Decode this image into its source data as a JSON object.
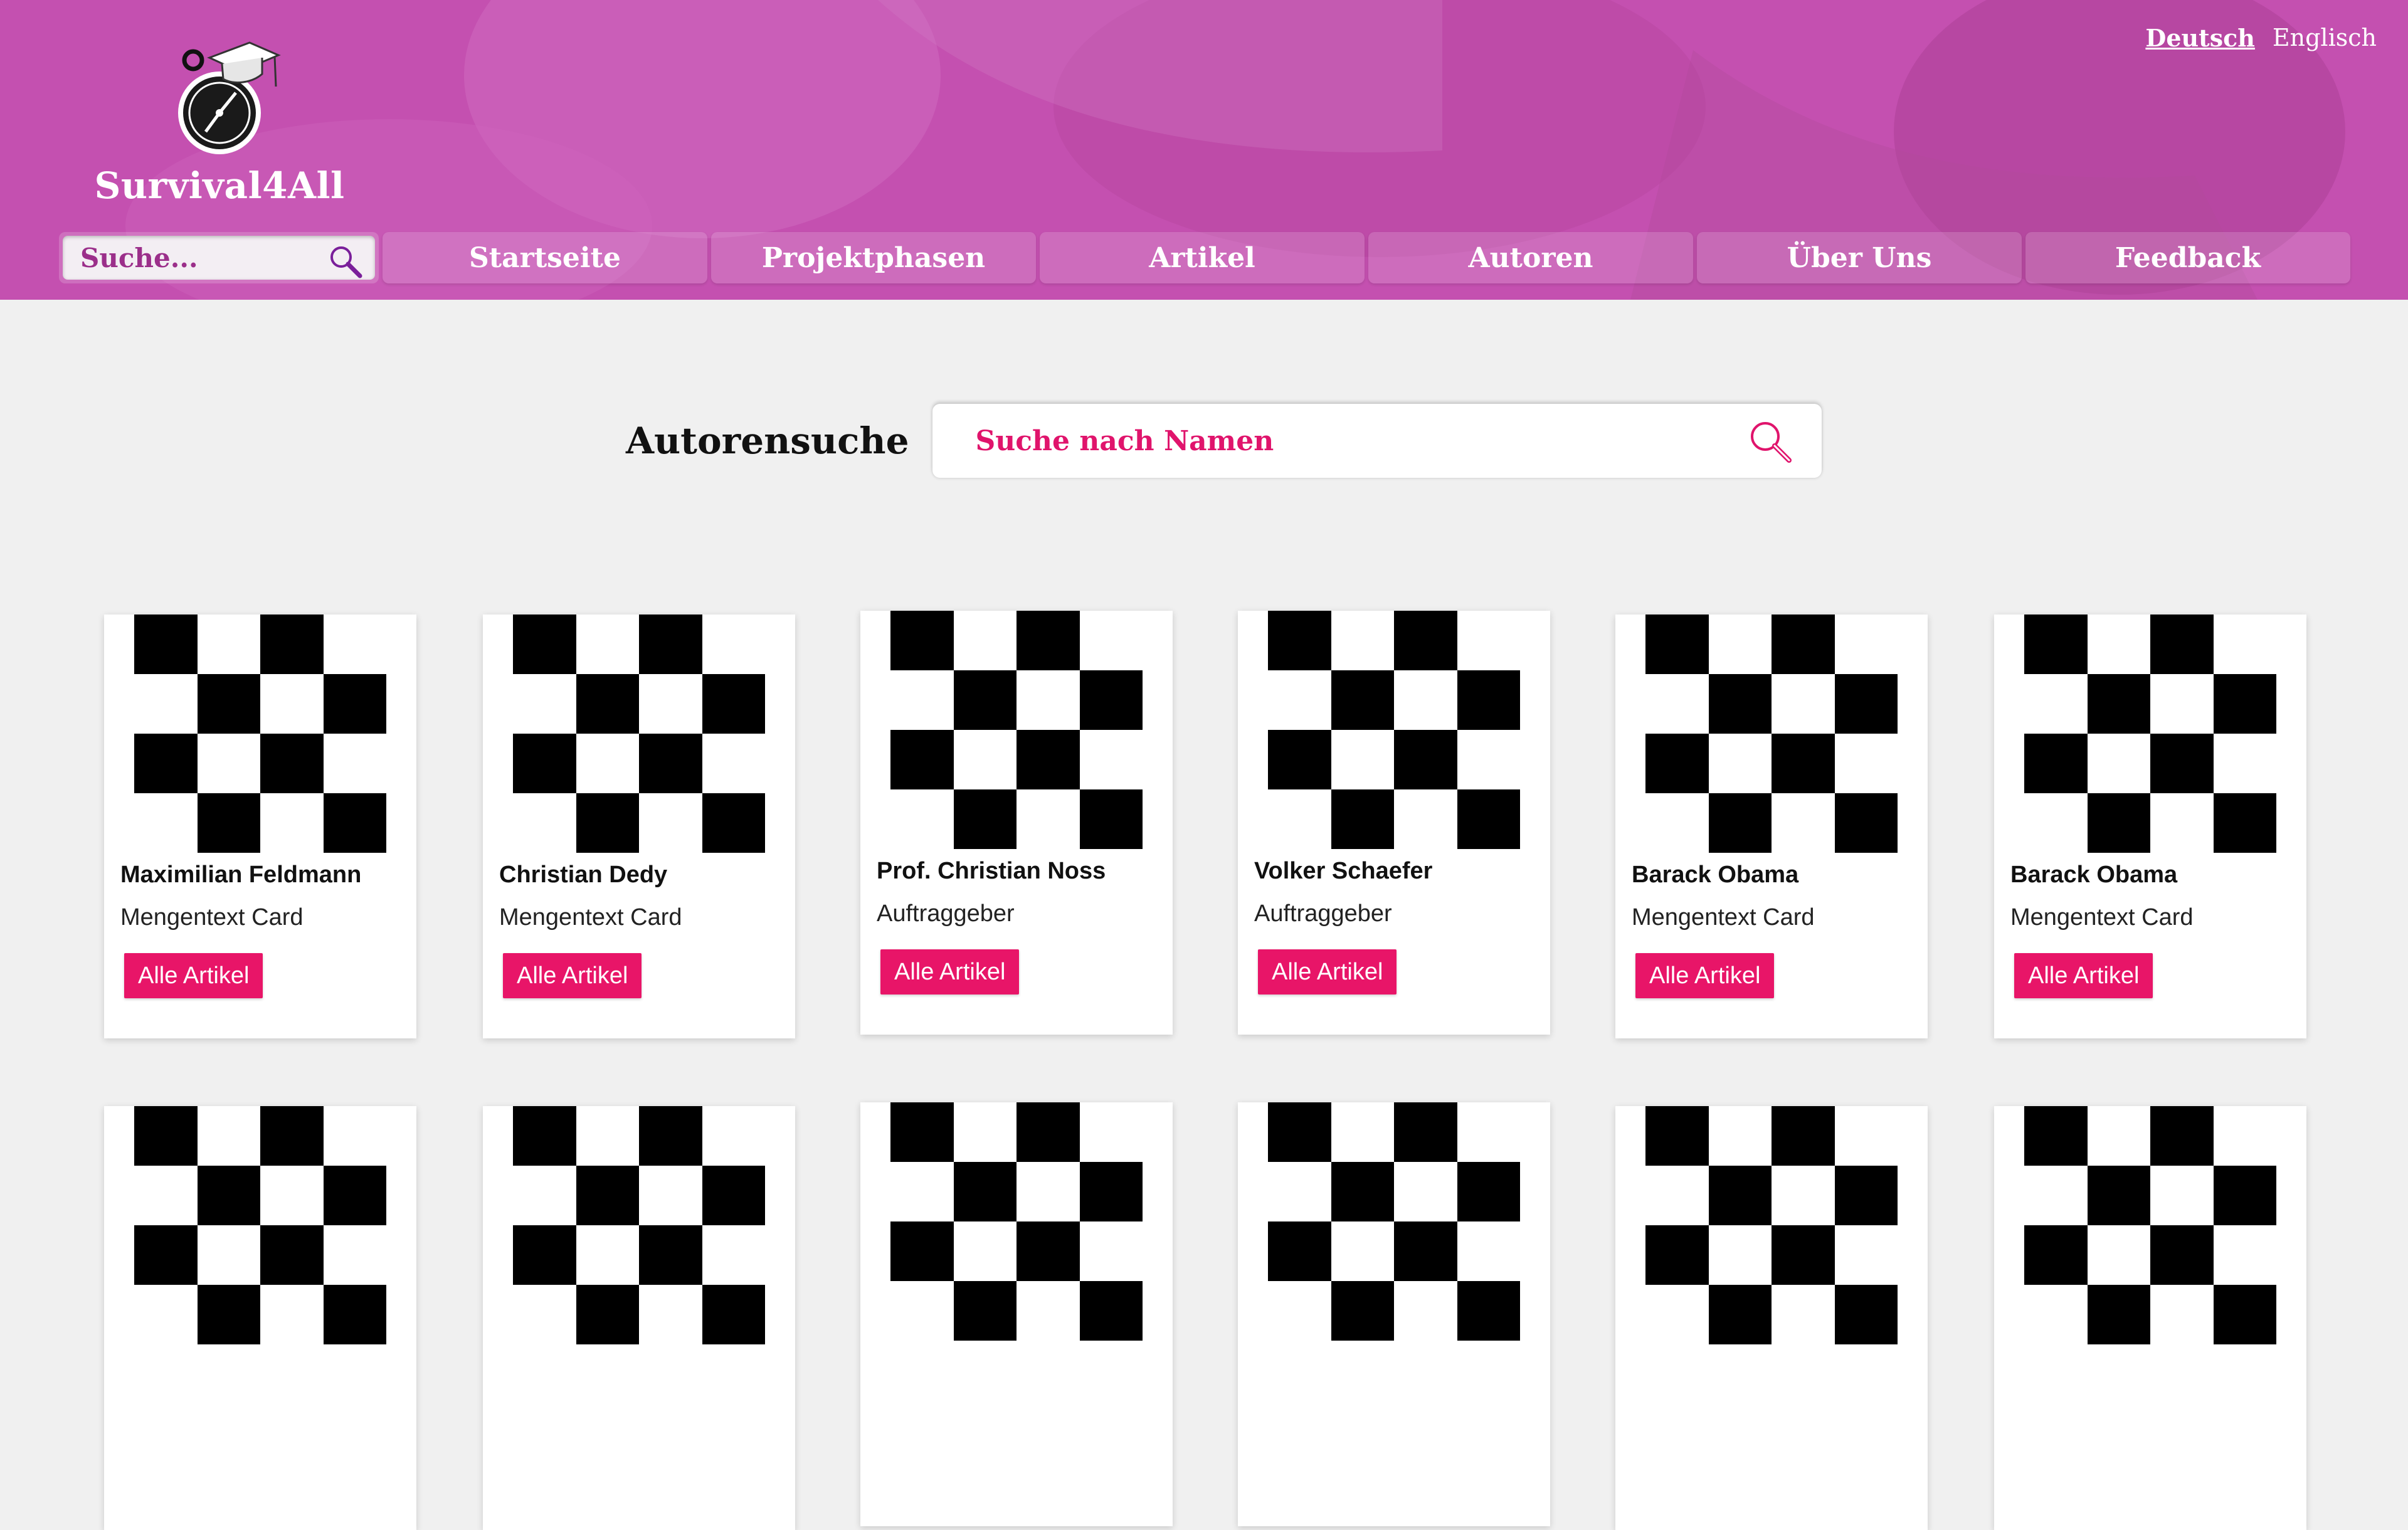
{
  "site": {
    "name": "Survival4All"
  },
  "languages": [
    {
      "label": "Deutsch",
      "active": true
    },
    {
      "label": "Englisch",
      "active": false
    }
  ],
  "nav": {
    "search_placeholder": "Suche...",
    "items": [
      {
        "label": "Startseite"
      },
      {
        "label": "Projektphasen"
      },
      {
        "label": "Artikel"
      },
      {
        "label": "Autoren"
      },
      {
        "label": "Über Uns"
      },
      {
        "label": "Feedback"
      }
    ]
  },
  "author_search": {
    "title": "Autorensuche",
    "placeholder": "Suche nach Namen"
  },
  "authors": [
    {
      "name": "Maximilian Feldmann",
      "role": "Mengentext Card",
      "button": "Alle Artikel"
    },
    {
      "name": "Christian Dedy",
      "role": "Mengentext Card",
      "button": "Alle Artikel"
    },
    {
      "name": "Prof. Christian Noss",
      "role": "Auftraggeber",
      "button": "Alle Artikel"
    },
    {
      "name": "Volker Schaefer",
      "role": "Auftraggeber",
      "button": "Alle Artikel"
    },
    {
      "name": "Barack Obama",
      "role": "Mengentext Card",
      "button": "Alle Artikel"
    },
    {
      "name": "Barack Obama",
      "role": "Mengentext Card",
      "button": "Alle Artikel"
    }
  ],
  "second_row_placeholders": 6,
  "colors": {
    "header": "#c450b0",
    "accent": "#e81568",
    "page_bg": "#f0f0f0"
  },
  "icons": {
    "logo": "stopwatch-graduation-cap-icon",
    "search": "magnifier-icon"
  }
}
